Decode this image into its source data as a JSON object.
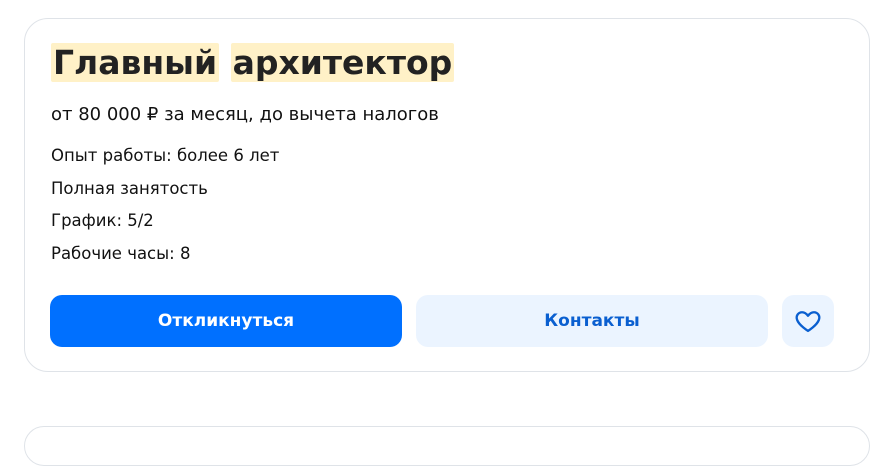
{
  "vacancy": {
    "title_words": [
      "Главный",
      "архитектор"
    ],
    "salary": "от 80 000 ₽ за месяц, до вычета налогов",
    "attributes": [
      "Опыт работы: более 6 лет",
      "Полная занятость",
      "График: 5/2",
      "Рабочие часы: 8"
    ]
  },
  "actions": {
    "apply_label": "Откликнуться",
    "contacts_label": "Контакты",
    "favorite_icon": "heart-icon"
  },
  "colors": {
    "primary": "#0070ff",
    "secondary_bg": "#ebf4ff",
    "secondary_text": "#0a5fd0",
    "highlight": "#fff1c7",
    "border": "#dfe3e8"
  }
}
